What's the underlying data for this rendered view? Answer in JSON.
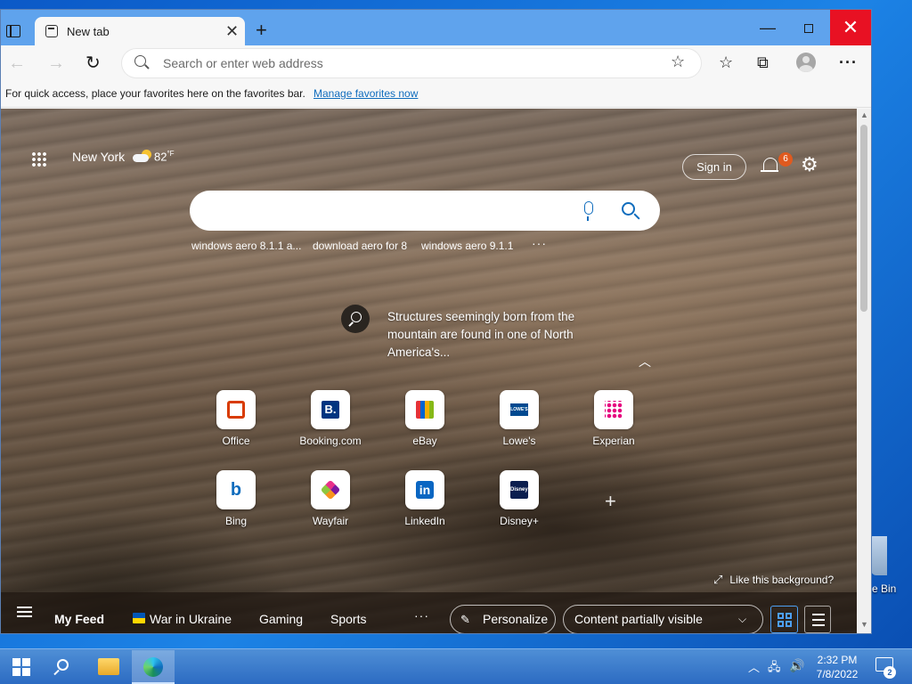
{
  "desktop": {
    "recycle_bin_label": "e Bin"
  },
  "browser": {
    "tab_title": "New tab",
    "tab_close": "✕",
    "new_tab": "+",
    "window_controls": {
      "minimize": "—",
      "close": "✕"
    },
    "toolbar": {
      "back": "←",
      "forward": "→",
      "refresh": "↻",
      "address_placeholder": "Search or enter web address",
      "favorite_icon": "☆",
      "favorites": "☆",
      "collections": "⧉",
      "more": "···"
    },
    "favorites_bar": {
      "text": "For quick access, place your favorites here on the favorites bar.",
      "link": "Manage favorites now"
    }
  },
  "newtab": {
    "weather": {
      "city": "New York",
      "temp": "82",
      "unit": "°F"
    },
    "sign_in": "Sign in",
    "notification_count": "6",
    "settings_icon": "⚙",
    "trending": [
      "windows aero 8.1.1 a...",
      "download aero for 8",
      "windows aero 9.1.1"
    ],
    "trending_more": "···",
    "story": "Structures seemingly born from the mountain are found in one of North America's...",
    "caret_up": "︿",
    "tiles": [
      {
        "label": "Office",
        "glyph": "O"
      },
      {
        "label": "Booking.com",
        "glyph": "B."
      },
      {
        "label": "eBay",
        "glyph": ""
      },
      {
        "label": "Lowe's",
        "glyph": "LOWE'S"
      },
      {
        "label": "Experian",
        "glyph": ""
      },
      {
        "label": "Bing",
        "glyph": "b"
      },
      {
        "label": "Wayfair",
        "glyph": ""
      },
      {
        "label": "LinkedIn",
        "glyph": "in"
      },
      {
        "label": "Disney+",
        "glyph": "Disney+"
      }
    ],
    "add_tile": "+",
    "like_background": "Like this background?",
    "feed": {
      "my_feed": "My Feed",
      "war_in_ukraine": "War in Ukraine",
      "gaming": "Gaming",
      "sports": "Sports",
      "more": "···",
      "personalize": "Personalize",
      "content_visibility": "Content partially visible",
      "chevron": "⌵"
    }
  },
  "taskbar": {
    "time": "2:32 PM",
    "date": "7/8/2022",
    "notification_count": "2",
    "tray_chevron": "︿",
    "network_icon": "🖧",
    "volume_icon": "🔊"
  }
}
